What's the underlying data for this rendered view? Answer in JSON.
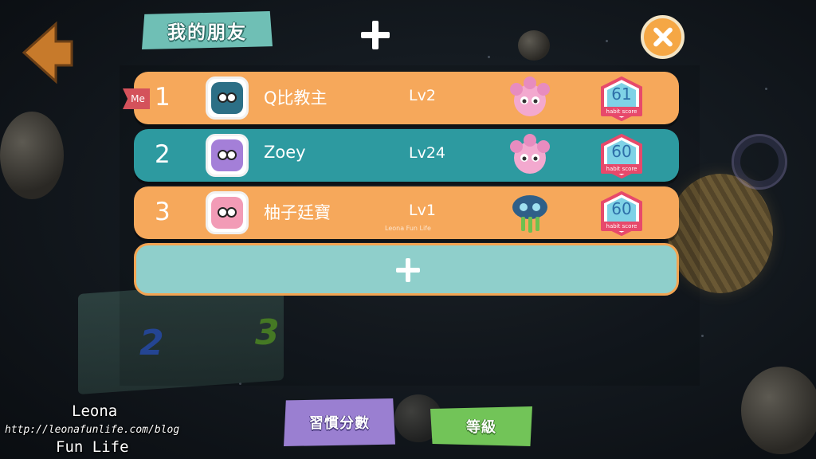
{
  "header": {
    "title": "我的朋友",
    "add_icon": "plus-icon",
    "close_icon": "close-icon",
    "back_icon": "arrow-left-icon"
  },
  "me_tag": "Me",
  "rows": [
    {
      "rank": "1",
      "name": "Q比教主",
      "level": "Lv2",
      "score": "61",
      "score_caption": "habit score",
      "row_color": "#f6a85b",
      "avatar_color": "#2c6f86",
      "pet": "pink-fluffy-pet"
    },
    {
      "rank": "2",
      "name": "Zoey",
      "level": "Lv24",
      "score": "60",
      "score_caption": "habit score",
      "row_color": "#2d9aa0",
      "avatar_color": "#a47fd8",
      "pet": "pink-fluffy-pet"
    },
    {
      "rank": "3",
      "name": "柚子廷寶",
      "level": "Lv1",
      "score": "60",
      "score_caption": "habit score",
      "row_color": "#f6a85b",
      "avatar_color": "#f29bb6",
      "pet": "blue-tentacle-pet"
    }
  ],
  "add_row_icon": "plus-icon",
  "row_watermark": "Leona Fun Life",
  "bottom": {
    "habit_analysis": "習慣分數",
    "ranking": "等級"
  },
  "watermark": {
    "line1": "Leona",
    "line2": "http://leonafunlife.com/blog",
    "line3": "Fun Life"
  }
}
